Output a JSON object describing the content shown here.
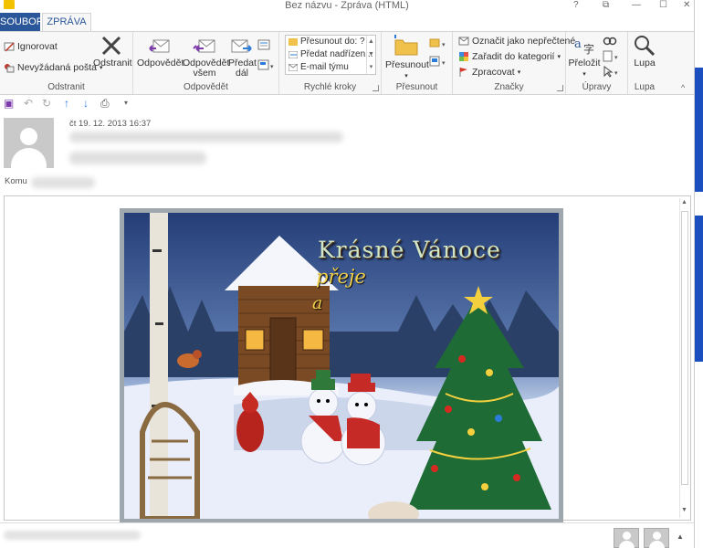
{
  "window": {
    "title": "Bez názvu - Zpráva (HTML)",
    "controls": [
      "?",
      "⧉",
      "—",
      "☐",
      "✕"
    ]
  },
  "tabs": {
    "file": "SOUBOR",
    "message": "ZPRÁVA"
  },
  "ribbon": {
    "delete_group": {
      "ignore": "Ignorovat",
      "junk": "Nevyžádaná pošta",
      "delete": "Odstranit",
      "label": "Odstranit"
    },
    "respond_group": {
      "reply": "Odpovědět",
      "reply_all_1": "Odpovědět",
      "reply_all_2": "všem",
      "forward_1": "Předat",
      "forward_2": "dál",
      "label": "Odpovědět"
    },
    "quick_steps": {
      "items": [
        "Přesunout do: ?",
        "Předat nadřízen...",
        "E-mail týmu"
      ],
      "label": "Rychlé kroky"
    },
    "move_group": {
      "move": "Přesunout",
      "label": "Přesunout"
    },
    "tags_group": {
      "unread": "Označit jako nepřečtené",
      "categorize": "Zařadit do kategorií",
      "followup": "Zpracovat",
      "label": "Značky"
    },
    "editing_group": {
      "translate": "Přeložit",
      "label": "Úpravy"
    },
    "zoom_group": {
      "zoom": "Lupa",
      "label": "Lupa"
    }
  },
  "header": {
    "date": "čt 19. 12. 2013 16:37",
    "to_label": "Komu"
  },
  "card": {
    "title": "Krásné Vánoce",
    "line1": "přeje",
    "line2": "a"
  },
  "colors": {
    "accent": "#2b579a",
    "ribbon_bg": "#f7f7f7"
  }
}
